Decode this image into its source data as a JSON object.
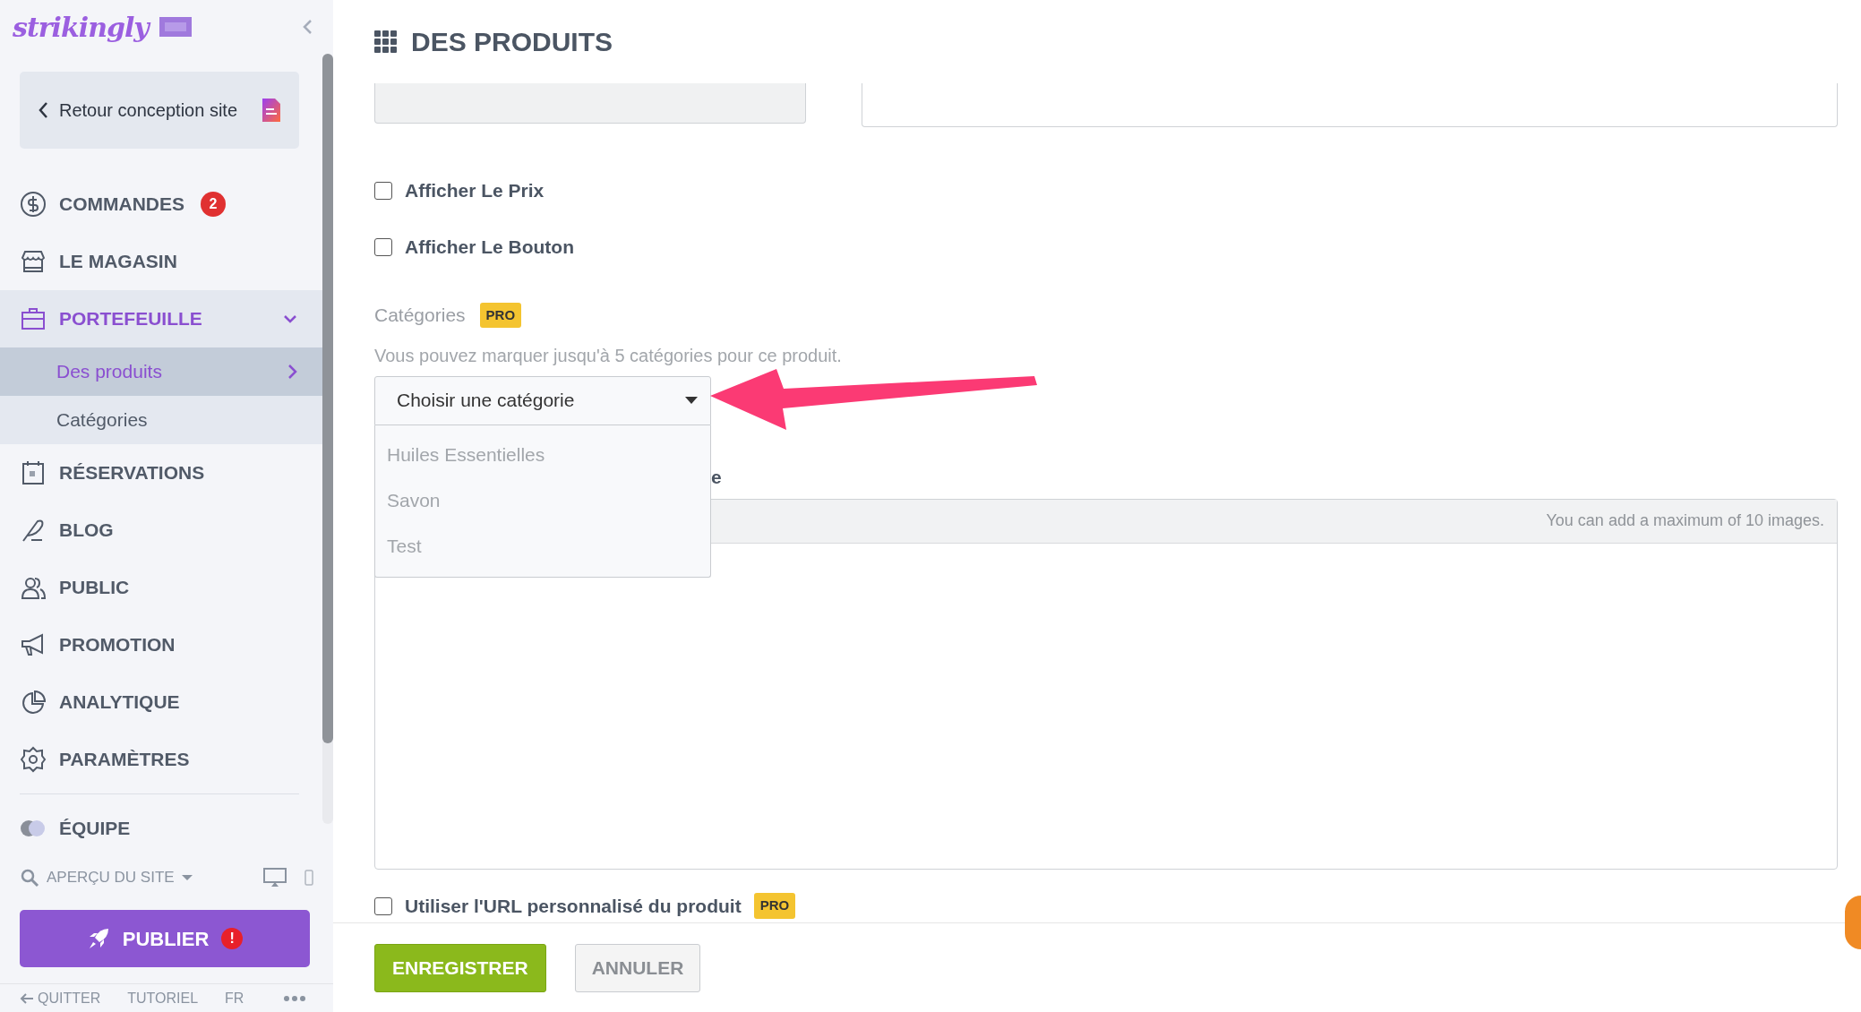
{
  "sidebar": {
    "logo": "strikingly",
    "back_button": "Retour conception site",
    "nav": [
      {
        "label": "COMMANDES",
        "badge": "2",
        "selected": false
      },
      {
        "label": "LE MAGASIN",
        "selected": false
      },
      {
        "label": "PORTEFEUILLE",
        "selected": true,
        "expanded": true,
        "children": [
          {
            "label": "Des produits",
            "selected": true
          },
          {
            "label": "Catégories",
            "selected": false
          }
        ]
      },
      {
        "label": "RÉSERVATIONS",
        "selected": false
      },
      {
        "label": "BLOG",
        "selected": false
      },
      {
        "label": "PUBLIC",
        "selected": false
      },
      {
        "label": "PROMOTION",
        "selected": false
      },
      {
        "label": "ANALYTIQUE",
        "selected": false
      },
      {
        "label": "PARAMÈTRES",
        "selected": false
      },
      {
        "label": "ÉQUIPE",
        "selected": false
      }
    ],
    "preview": "APERÇU DU SITE",
    "publish": {
      "label": "PUBLIER",
      "alert": "!"
    },
    "footer_links": [
      "QUITTER",
      "TUTORIEL",
      "FR"
    ]
  },
  "main": {
    "title": "DES PRODUITS",
    "checkboxes": [
      {
        "label": "Afficher Le Prix",
        "checked": false
      },
      {
        "label": "Afficher Le Bouton",
        "checked": false
      }
    ],
    "categories": {
      "label": "Catégories",
      "badge": "PRO",
      "help": "Vous pouvez marquer jusqu'à 5 catégories pour ce produit.",
      "select": {
        "value": "Choisir une catégorie",
        "expanded": true,
        "options": [
          "Huiles Essentielles",
          "Savon",
          "Test"
        ]
      }
    },
    "images": {
      "label_fragment": "e",
      "note": "You can add a maximum of 10 images."
    },
    "custom_url": {
      "label": "Utiliser l'URL personnalisé du produit",
      "checked": false,
      "badge": "PRO"
    },
    "buttons": {
      "save": "ENREGISTRER",
      "cancel": "ANNULER"
    }
  }
}
